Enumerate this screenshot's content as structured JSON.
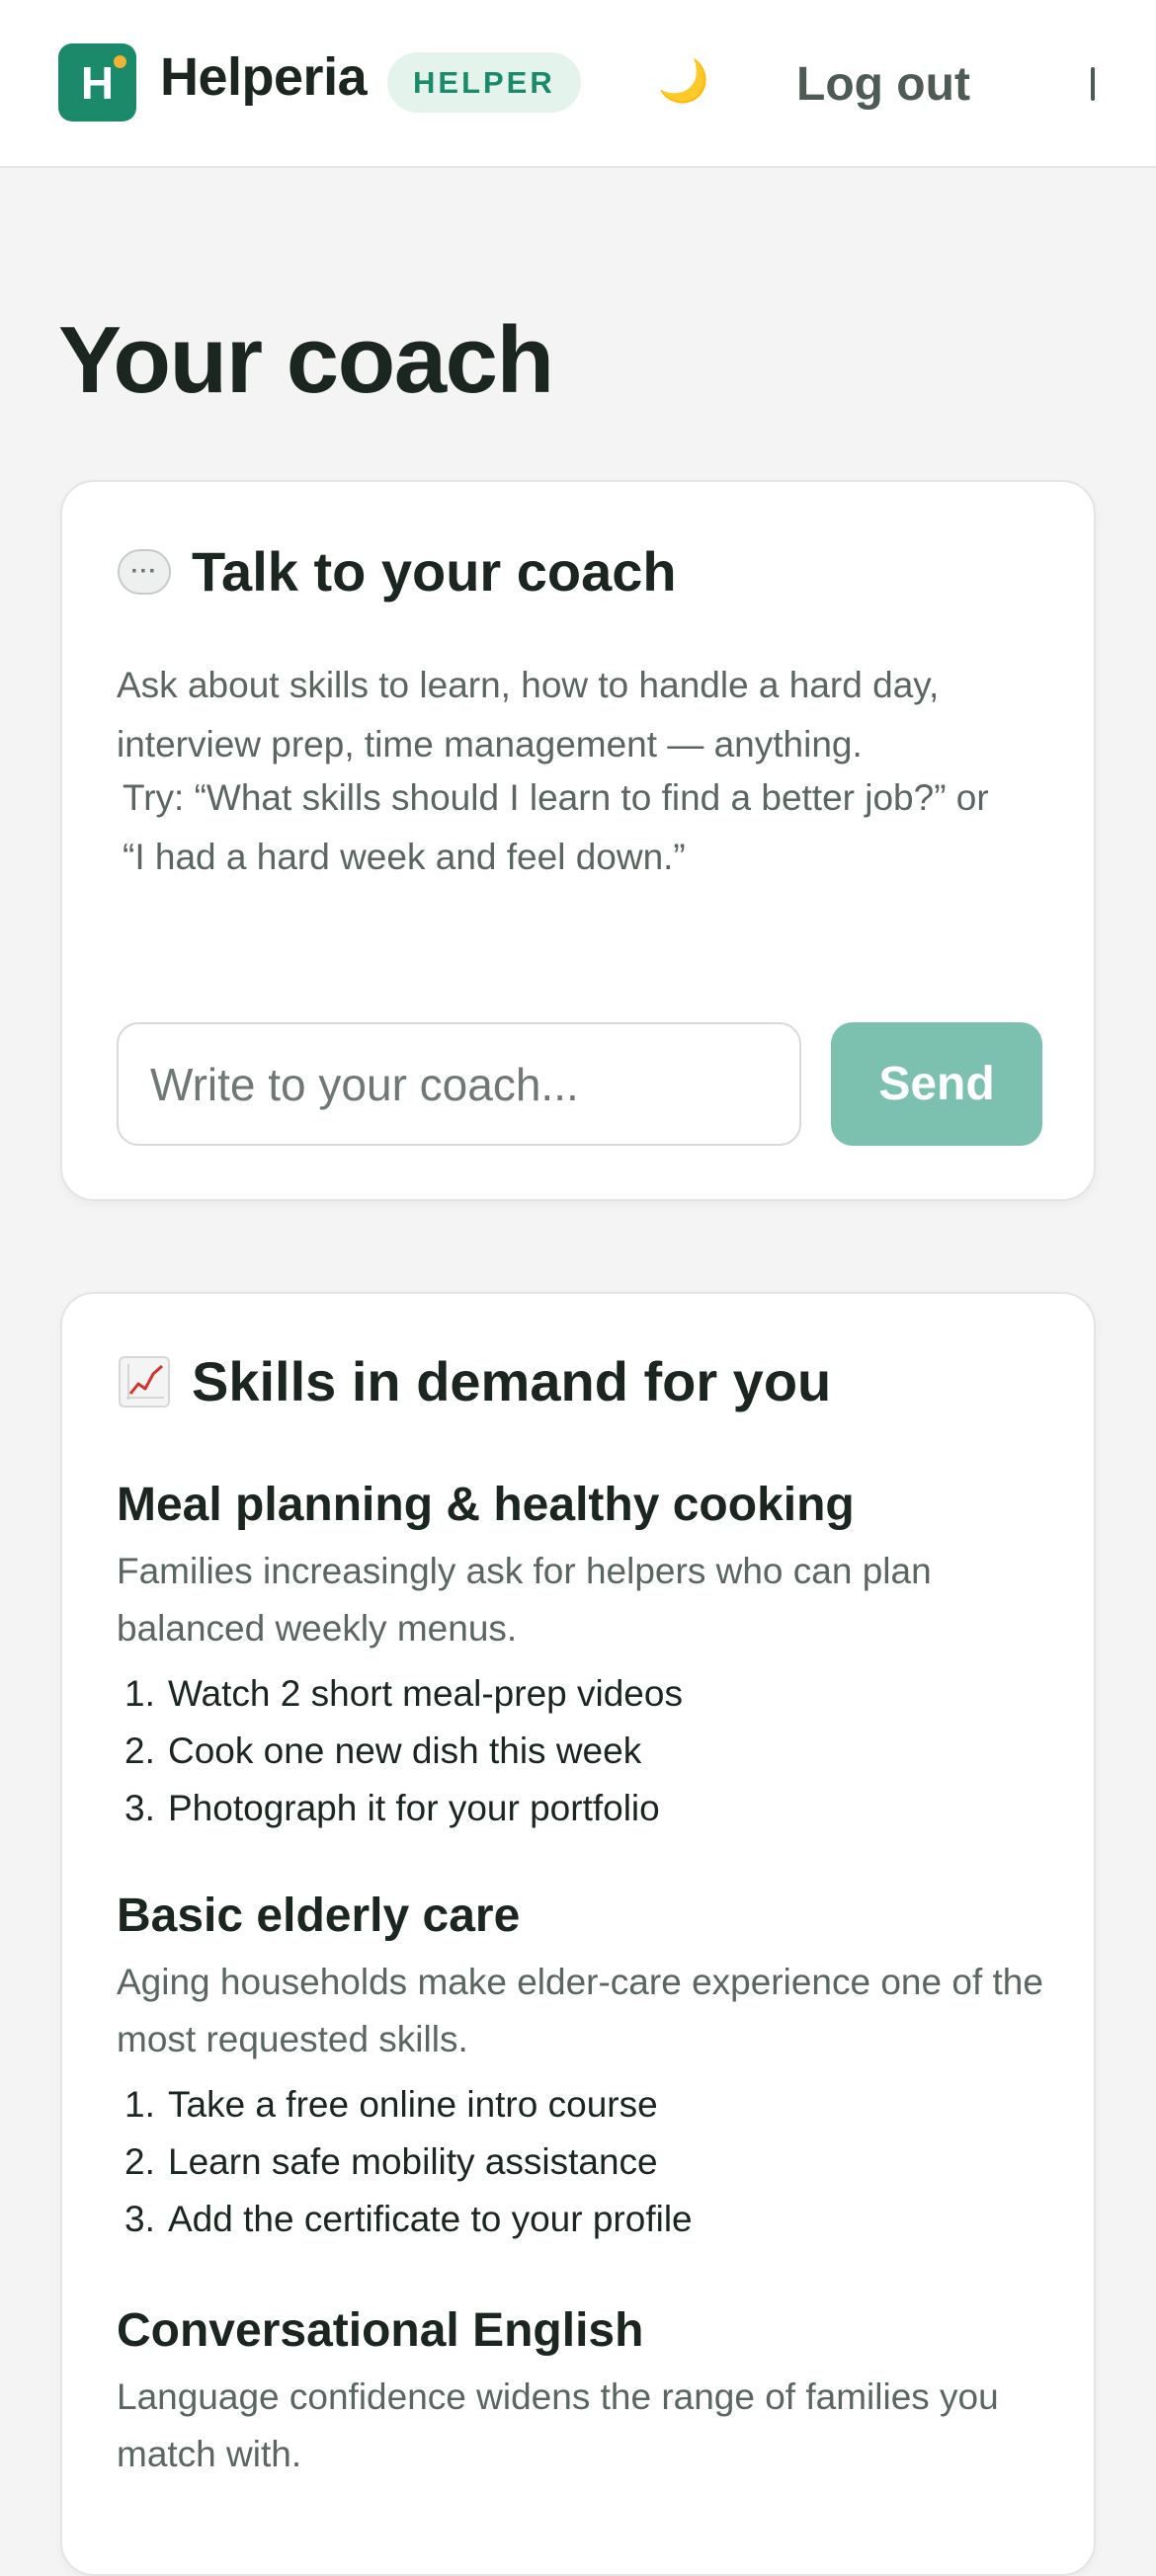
{
  "header": {
    "logo_letter": "H",
    "brand": "Helperia",
    "role_badge": "HELPER",
    "theme_toggle_glyph": "🌙",
    "logout_label": "Log out"
  },
  "page": {
    "title": "Your coach"
  },
  "coach_card": {
    "icon": "speech-bubble-icon",
    "title": "Talk to your coach",
    "description": "Ask about skills to learn, how to handle a hard day, interview prep, time management — anything.",
    "try_text": "Try: “What skills should I learn to find a better job?” or “I had a hard week and feel down.”",
    "input_placeholder": "Write to your coach...",
    "input_value": "",
    "send_label": "Send"
  },
  "skills_card": {
    "icon": "chart-increasing-icon",
    "title": "Skills in demand for you",
    "skills": [
      {
        "name": "Meal planning & healthy cooking",
        "description": "Families increasingly ask for helpers who can plan balanced weekly menus.",
        "steps": [
          {
            "n": "1.",
            "text": "Watch 2 short meal-prep videos"
          },
          {
            "n": "2.",
            "text": "Cook one new dish this week"
          },
          {
            "n": "3.",
            "text": "Photograph it for your portfolio"
          }
        ]
      },
      {
        "name": "Basic elderly care",
        "description": "Aging households make elder-care experience one of the most requested skills.",
        "steps": [
          {
            "n": "1.",
            "text": "Take a free online intro course"
          },
          {
            "n": "2.",
            "text": "Learn safe mobility assistance"
          },
          {
            "n": "3.",
            "text": "Add the certificate to your profile"
          }
        ]
      },
      {
        "name": "Conversational English",
        "description": "Language confidence widens the range of families you match with."
      }
    ]
  },
  "colors": {
    "brand": "#1b8a6b",
    "badge_bg": "#e4f4ec",
    "send_button": "#7cc1b0",
    "page_bg": "#f3f4f3"
  }
}
